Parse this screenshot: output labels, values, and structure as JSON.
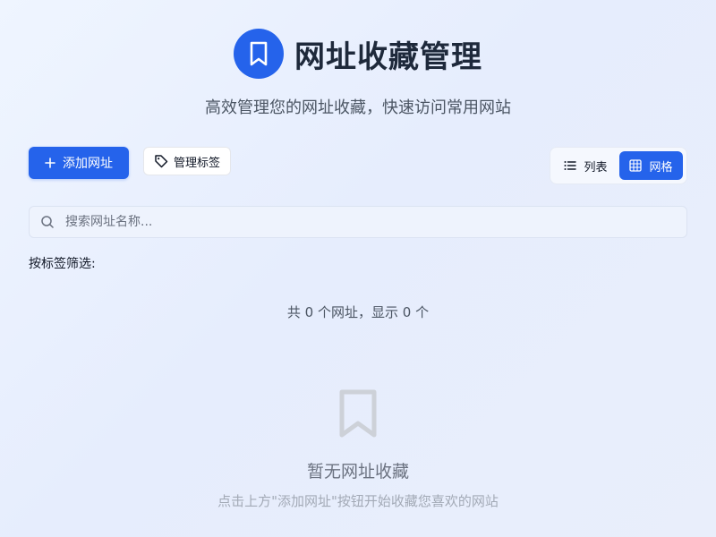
{
  "header": {
    "title": "网址收藏管理",
    "subtitle": "高效管理您的网址收藏，快速访问常用网站",
    "logo_icon": "bookmark-icon"
  },
  "toolbar": {
    "add_label": "添加网址",
    "add_icon": "plus-icon",
    "tags_label": "管理标签",
    "tags_icon": "tag-icon"
  },
  "view_toggle": {
    "list_label": "列表",
    "list_icon": "list-icon",
    "grid_label": "网格",
    "grid_icon": "grid-icon",
    "active": "grid"
  },
  "search": {
    "placeholder": "搜索网址名称...",
    "value": "",
    "icon": "search-icon"
  },
  "filter": {
    "label": "按标签筛选:"
  },
  "summary": {
    "text": "共 0 个网址，显示 0 个"
  },
  "empty_state": {
    "icon": "bookmark-icon",
    "title": "暂无网址收藏",
    "hint": "点击上方\"添加网址\"按钮开始收藏您喜欢的网站"
  },
  "colors": {
    "accent": "#2563eb",
    "background": "#eef3fd",
    "muted_text": "#6b7280"
  }
}
